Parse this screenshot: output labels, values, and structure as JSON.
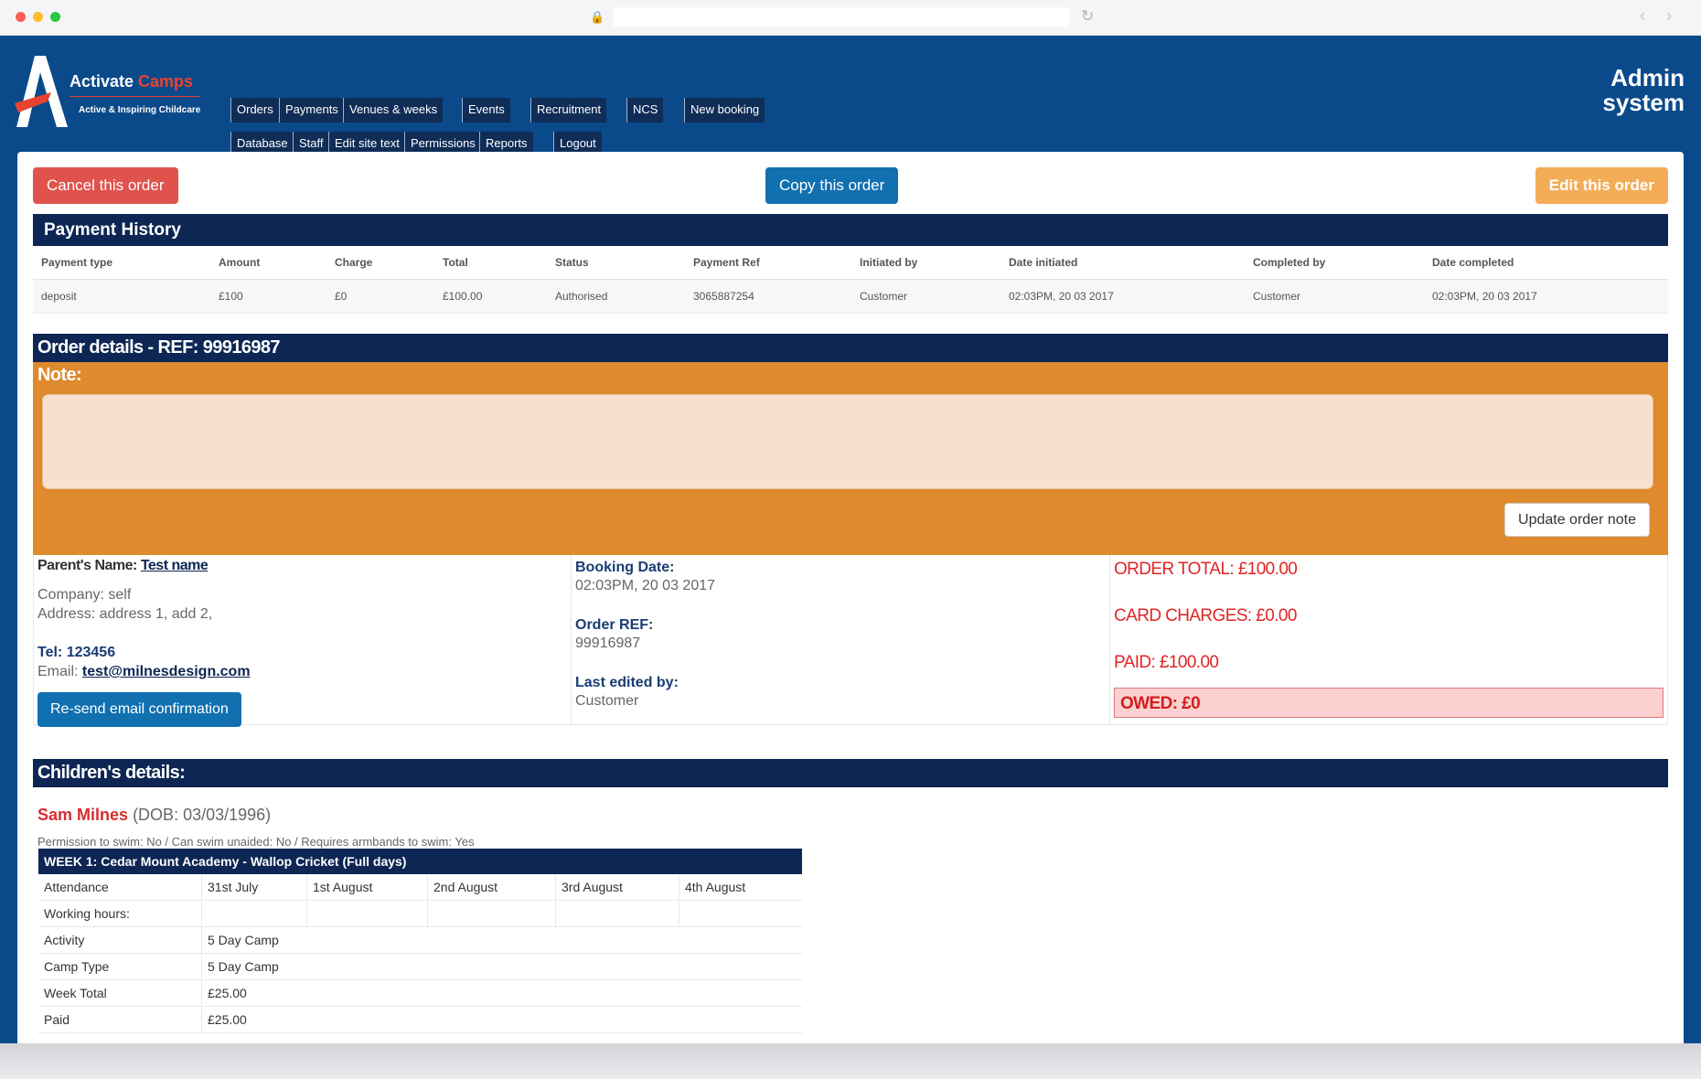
{
  "header": {
    "brand_activate": "Activate",
    "brand_camps": "Camps",
    "brand_tagline": "Active & Inspiring Childcare",
    "admin_line1": "Admin",
    "admin_line2": "system",
    "nav_row1": [
      "Orders",
      "Payments",
      "Venues & weeks",
      "Events",
      "Recruitment",
      "NCS",
      "New booking"
    ],
    "nav_row2": [
      "Database",
      "Staff",
      "Edit site text",
      "Permissions",
      "Reports",
      "Logout"
    ]
  },
  "actions": {
    "cancel": "Cancel this order",
    "copy": "Copy this order",
    "edit": "Edit this order"
  },
  "payment_history": {
    "title": "Payment History",
    "columns": [
      "Payment type",
      "Amount",
      "Charge",
      "Total",
      "Status",
      "Payment Ref",
      "Initiated by",
      "Date initiated",
      "Completed by",
      "Date completed"
    ],
    "rows": [
      [
        "deposit",
        "£100",
        "£0",
        "£100.00",
        "Authorised",
        "3065887254",
        "Customer",
        "02:03PM, 20 03 2017",
        "Customer",
        "02:03PM, 20 03 2017"
      ]
    ]
  },
  "order": {
    "title": "Order details - REF: 99916987",
    "note_label": "Note:",
    "note_value": "",
    "update_note_btn": "Update order note",
    "parent_label": "Parent's Name:",
    "parent_name": "Test name",
    "company": "Company: self",
    "address": "Address: address 1, add 2,",
    "tel": "Tel: 123456",
    "email_label": "Email:",
    "email": "test@milnesdesign.com",
    "resend_btn": "Re-send email confirmation",
    "booking_date_label": "Booking Date:",
    "booking_date": "02:03PM, 20 03 2017",
    "order_ref_label": "Order REF:",
    "order_ref": "99916987",
    "last_edited_label": "Last edited by:",
    "last_edited": "Customer",
    "order_total": "ORDER TOTAL: £100.00",
    "card_charges": "CARD CHARGES: £0.00",
    "paid": "PAID: £100.00",
    "owed": "OWED: £0"
  },
  "children": {
    "title": "Children's details:",
    "child_name": "Sam Milnes",
    "child_dob": "(DOB: 03/03/1996)",
    "swim_info": "Permission to swim: No / Can swim unaided: No / Requires armbands to swim: Yes",
    "week_title": "WEEK 1: Cedar Mount Academy - Wallop Cricket (Full days)",
    "attendance_label": "Attendance",
    "days": [
      "31st July",
      "1st August",
      "2nd August",
      "3rd August",
      "4th August"
    ],
    "working_hours_label": "Working hours:",
    "rows": [
      {
        "label": "Activity",
        "value": "5 Day Camp"
      },
      {
        "label": "Camp Type",
        "value": "5 Day Camp"
      },
      {
        "label": "Week Total",
        "value": "£25.00"
      },
      {
        "label": "Paid",
        "value": "£25.00"
      }
    ]
  }
}
